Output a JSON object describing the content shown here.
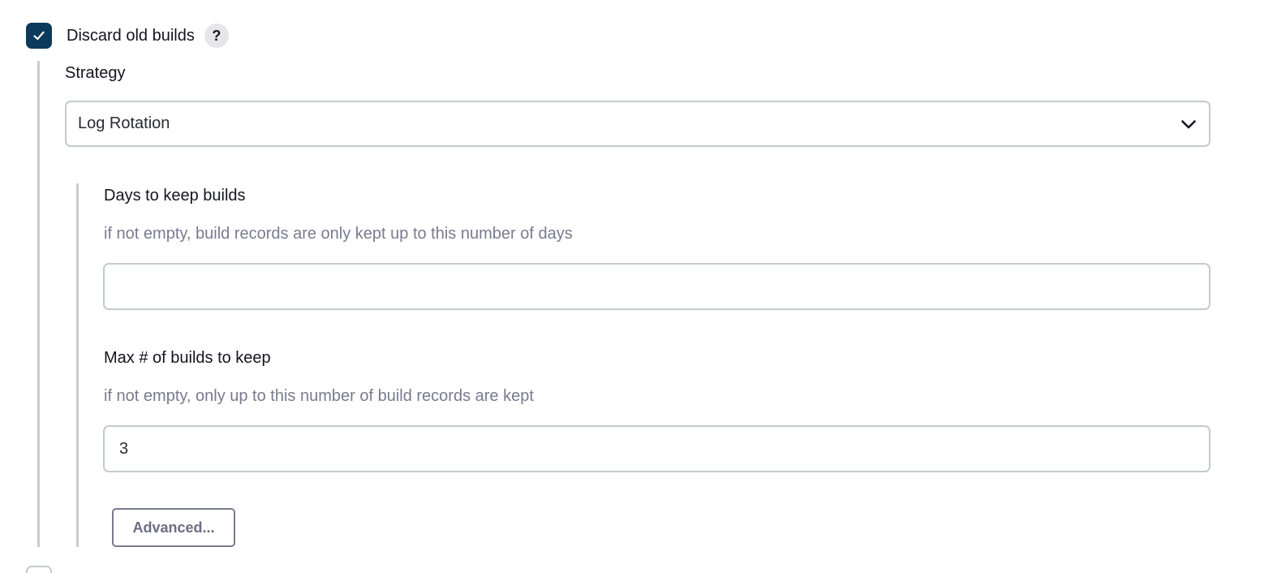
{
  "discard_old_builds": {
    "label": "Discard old builds",
    "checked": true,
    "help_label": "?"
  },
  "strategy": {
    "label": "Strategy",
    "selected": "Log Rotation"
  },
  "days_to_keep": {
    "label": "Days to keep builds",
    "hint": "if not empty, build records are only kept up to this number of days",
    "value": ""
  },
  "max_builds": {
    "label": "Max # of builds to keep",
    "hint": "if not empty, only up to this number of build records are kept",
    "value": "3"
  },
  "advanced_button": {
    "label": "Advanced..."
  },
  "icons": {
    "checkbox": "check-icon",
    "select_arrow": "chevron-down-icon"
  },
  "colors": {
    "checkbox_fill": "#0b3b5c",
    "hint_text": "#7a7a8f",
    "border": "#c3cbd1"
  }
}
